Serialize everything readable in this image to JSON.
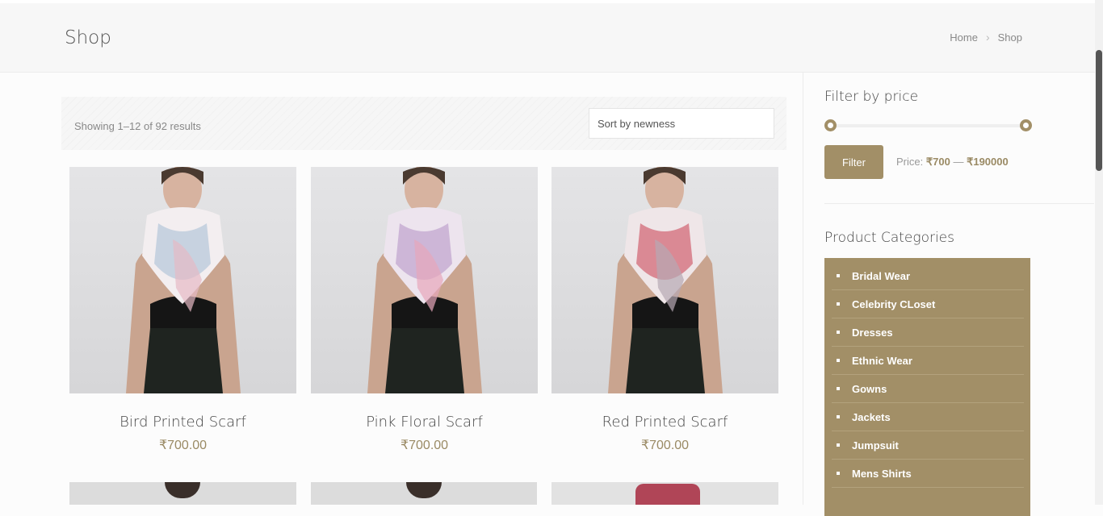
{
  "page": {
    "title": "Shop"
  },
  "breadcrumb": {
    "home": "Home",
    "separator": "›",
    "current": "Shop"
  },
  "toolbar": {
    "result_count": "Showing 1–12 of 92 results",
    "sort_value": "Sort by newness"
  },
  "products": [
    {
      "name": "Bird Printed Scarf",
      "price": "₹700.00",
      "scarf_colors": [
        "#f3eef0",
        "#aac0d6",
        "#e6b9c5"
      ]
    },
    {
      "name": "Pink Floral Scarf",
      "price": "₹700.00",
      "scarf_colors": [
        "#ede4ee",
        "#b798c8",
        "#e7a7bb"
      ]
    },
    {
      "name": "Red Printed Scarf",
      "price": "₹700.00",
      "scarf_colors": [
        "#efe6e8",
        "#cc4b5c",
        "#b7a8b4"
      ]
    }
  ],
  "price_filter": {
    "title": "Filter by price",
    "button": "Filter",
    "label": "Price:",
    "min": "₹700",
    "dash": "—",
    "max": "₹190000",
    "range_fraction": [
      0,
      1
    ]
  },
  "categories": {
    "title": "Product Categories",
    "items": [
      "Bridal Wear",
      "Celebrity CLoset",
      "Dresses",
      "Ethnic Wear",
      "Gowns",
      "Jackets",
      "Jumpsuit",
      "Mens Shirts"
    ]
  },
  "colors": {
    "accent": "#a28f67",
    "price": "#9a8a64"
  }
}
